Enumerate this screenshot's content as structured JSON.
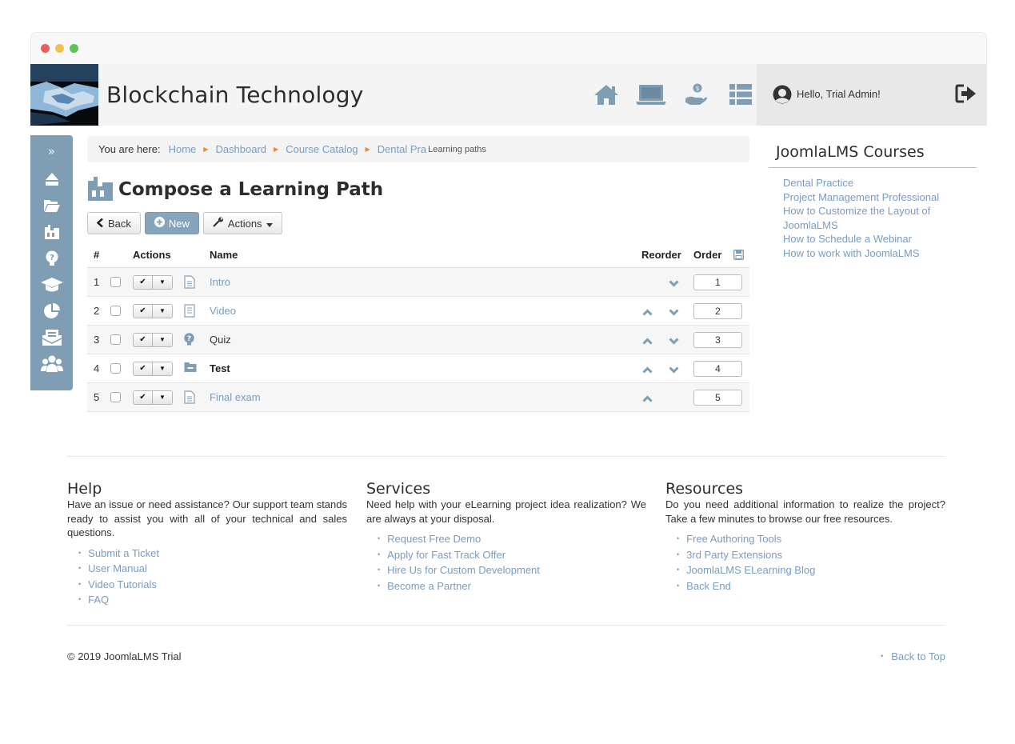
{
  "site": {
    "title": "Blockchain Technology",
    "logo_icon": "handshake-image"
  },
  "header_icons": [
    {
      "name": "home-icon"
    },
    {
      "name": "laptop-icon"
    },
    {
      "name": "hand-coin-icon"
    },
    {
      "name": "list-icon"
    }
  ],
  "user": {
    "greeting": "Hello, Trial Admin!"
  },
  "sidebar": {
    "toggle_label": "»"
  },
  "breadcrumb": {
    "label": "You are here:",
    "items": [
      "Home",
      "Dashboard",
      "Course Catalog",
      "Dental Pra"
    ],
    "current": "Learning paths"
  },
  "page": {
    "title": "Compose a Learning Path"
  },
  "toolbar": {
    "back_label": "Back",
    "new_label": "New",
    "actions_label": "Actions"
  },
  "table": {
    "headers": {
      "num": "#",
      "actions": "Actions",
      "name": "Name",
      "reorder": "Reorder",
      "order": "Order"
    },
    "rows": [
      {
        "num": "1",
        "name": "Intro",
        "icon": "document-icon",
        "order": "1"
      },
      {
        "num": "2",
        "name": "Video",
        "icon": "document-icon",
        "order": "2"
      },
      {
        "num": "3",
        "name": "Quiz",
        "icon": "quiz-icon",
        "order": "3"
      },
      {
        "num": "4",
        "name": "Test",
        "icon": "folder-icon",
        "order": "4"
      },
      {
        "num": "5",
        "name": "Final exam",
        "icon": "document-icon",
        "order": "5"
      }
    ]
  },
  "courses": {
    "title": "JoomlaLMS Courses",
    "items": [
      "Dental Practice",
      "Project Management Professional",
      "How to Customize the Layout of JoomlaLMS",
      "How to Schedule a Webinar",
      "How to work with JoomlaLMS"
    ]
  },
  "footer": {
    "help": {
      "title": "Help",
      "text": "Have an issue or need assistance? Our support team stands ready to assist you with all of your technical and sales questions.",
      "links": [
        "Submit a Ticket",
        "User Manual",
        "Video Tutorials",
        "FAQ"
      ]
    },
    "services": {
      "title": "Services",
      "text": "Need help with your eLearning project idea realization? We are always at your disposal.",
      "links": [
        "Request Free Demo",
        "Apply for Fast Track Offer",
        "Hire Us for Custom Development",
        "Become a Partner"
      ]
    },
    "resources": {
      "title": "Resources",
      "text": "Do you need additional information to realize the project? Take a few minutes to browse our free resources.",
      "links": [
        "Free Authoring Tools",
        "3rd Party Extensions",
        "JoomlaLMS ELearning Blog",
        "Back End"
      ]
    },
    "copyright": "© 2019 JoomlaLMS Trial",
    "back_to_top": "Back to Top"
  },
  "colors": {
    "accent": "#7f9db3",
    "link": "#7a9cc0",
    "breadcrumb_sep": "#e8883d"
  }
}
